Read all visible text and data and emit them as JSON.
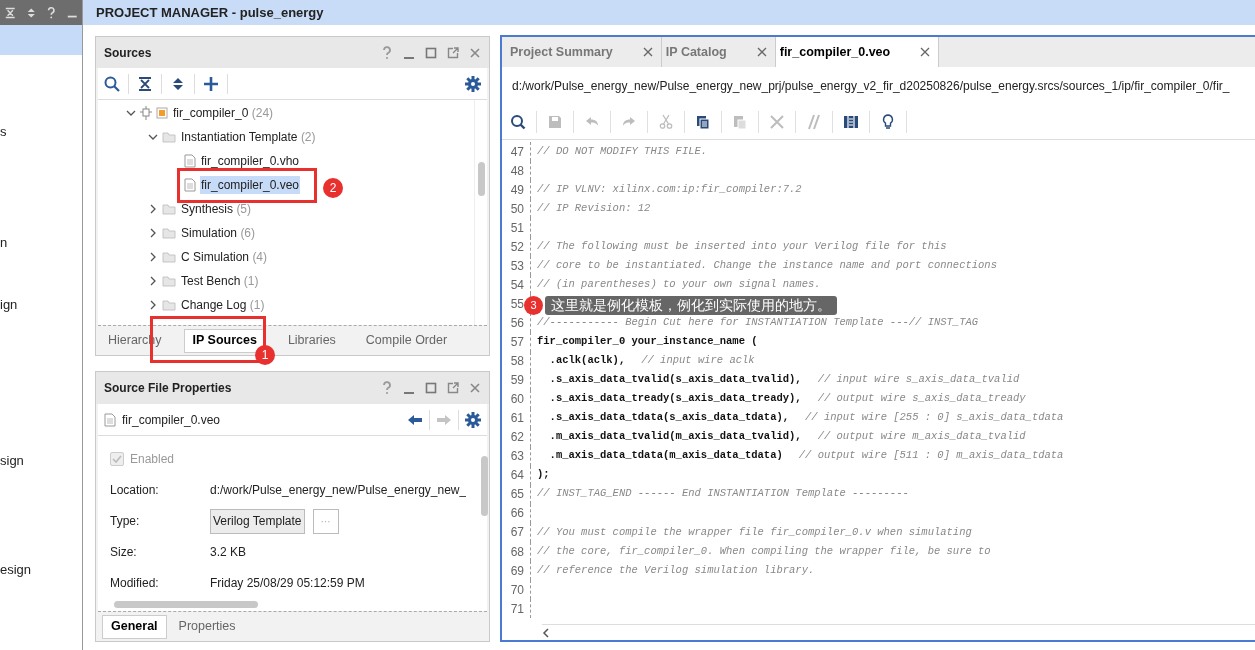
{
  "left_nav": {
    "items": [
      {
        "label": "s"
      },
      {
        "label": "n"
      },
      {
        "label": "ign"
      },
      {
        "label": "sign"
      },
      {
        "label": "esign"
      }
    ]
  },
  "title": "PROJECT MANAGER - pulse_energy",
  "sources": {
    "title": "Sources",
    "tree": [
      {
        "label": "fir_compiler_0",
        "count": "(24)",
        "kind": "ip",
        "expanded": true,
        "children": [
          {
            "label": "Instantiation Template",
            "count": "(2)",
            "kind": "folder",
            "expanded": true,
            "children": [
              {
                "label": "fir_compiler_0.vho",
                "kind": "file",
                "selected": false
              },
              {
                "label": "fir_compiler_0.veo",
                "kind": "file",
                "selected": true
              }
            ]
          },
          {
            "label": "Synthesis",
            "count": "(5)",
            "kind": "folder",
            "expanded": false
          },
          {
            "label": "Simulation",
            "count": "(6)",
            "kind": "folder",
            "expanded": false
          },
          {
            "label": "C Simulation",
            "count": "(4)",
            "kind": "folder",
            "expanded": false
          },
          {
            "label": "Test Bench",
            "count": "(1)",
            "kind": "folder",
            "expanded": false
          },
          {
            "label": "Change Log",
            "count": "(1)",
            "kind": "folder",
            "expanded": false
          }
        ]
      }
    ],
    "tabs": [
      {
        "label": "Hierarchy",
        "selected": false
      },
      {
        "label": "IP Sources",
        "selected": true
      },
      {
        "label": "Libraries",
        "selected": false
      },
      {
        "label": "Compile Order",
        "selected": false
      }
    ]
  },
  "properties": {
    "title": "Source File Properties",
    "file": "fir_compiler_0.veo",
    "enabled": {
      "label": "Enabled",
      "checked": true,
      "disabled": true
    },
    "fields": [
      {
        "label": "Location:",
        "value": "d:/work/Pulse_energy_new/Pulse_energy_new_",
        "kind": "text"
      },
      {
        "label": "Type:",
        "value": "Verilog Template",
        "kind": "button",
        "extra": "···"
      },
      {
        "label": "Size:",
        "value": "3.2 KB",
        "kind": "text"
      },
      {
        "label": "Modified:",
        "value": "Friday 25/08/29 05:12:59 PM",
        "kind": "text"
      }
    ],
    "tabs": [
      {
        "label": "General",
        "selected": true
      },
      {
        "label": "Properties",
        "selected": false
      }
    ]
  },
  "editor": {
    "tabs": [
      {
        "label": "Project Summary",
        "selected": false
      },
      {
        "label": "IP Catalog",
        "selected": false
      },
      {
        "label": "fir_compiler_0.veo",
        "selected": true
      }
    ],
    "path": "d:/work/Pulse_energy_new/Pulse_energy_new_prj/pulse_energy_v2_fir_d20250826/pulse_energy.srcs/sources_1/ip/fir_compiler_0/fir_",
    "toolbar": [
      {
        "disabled": false
      },
      {
        "disabled": true
      },
      {
        "disabled": true
      },
      {
        "disabled": true
      },
      {
        "disabled": true
      },
      {
        "disabled": false
      },
      {
        "disabled": true
      },
      {
        "disabled": true
      },
      {
        "disabled": true
      },
      {
        "disabled": false
      },
      {
        "disabled": false
      }
    ],
    "lines": [
      {
        "number": "47",
        "text": "// DO NOT MODIFY THIS FILE.",
        "kind": "comment"
      },
      {
        "number": "48"
      },
      {
        "number": "49",
        "text": "// IP VLNV: xilinx.com:ip:fir_compiler:7.2",
        "kind": "comment"
      },
      {
        "number": "50",
        "text": "// IP Revision: 12",
        "kind": "comment"
      },
      {
        "number": "51"
      },
      {
        "number": "52",
        "text": "// The following must be inserted into your Verilog file for this",
        "kind": "comment"
      },
      {
        "number": "53",
        "text": "// core to be instantiated. Change the instance name and port connections",
        "kind": "comment"
      },
      {
        "number": "54",
        "text": "// (in parentheses) to your own signal names.",
        "kind": "comment"
      },
      {
        "number": "55"
      },
      {
        "number": "56",
        "text": "//----------- Begin Cut here for INSTANTIATION Template ---// INST_TAG",
        "kind": "comment"
      },
      {
        "number": "57",
        "text": "fir_compiler_0 your_instance_name (",
        "kind": "code"
      },
      {
        "number": "58",
        "text": "  .aclk(aclk),",
        "comment": "// input wire aclk",
        "kind": "code"
      },
      {
        "number": "59",
        "text": "  .s_axis_data_tvalid(s_axis_data_tvalid),",
        "comment": "// input wire s_axis_data_tvalid",
        "kind": "code"
      },
      {
        "number": "60",
        "text": "  .s_axis_data_tready(s_axis_data_tready),",
        "comment": "// output wire s_axis_data_tready",
        "kind": "code"
      },
      {
        "number": "61",
        "text": "  .s_axis_data_tdata(s_axis_data_tdata),",
        "comment": "// input wire [255 : 0] s_axis_data_tdata",
        "kind": "code"
      },
      {
        "number": "62",
        "text": "  .m_axis_data_tvalid(m_axis_data_tvalid),",
        "comment": "// output wire m_axis_data_tvalid",
        "kind": "code"
      },
      {
        "number": "63",
        "text": "  .m_axis_data_tdata(m_axis_data_tdata)",
        "comment": "// output wire [511 : 0] m_axis_data_tdata",
        "kind": "code"
      },
      {
        "number": "64",
        "text": ");",
        "kind": "code"
      },
      {
        "number": "65",
        "text": "// INST_TAG_END ------ End INSTANTIATION Template ---------",
        "kind": "comment"
      },
      {
        "number": "66"
      },
      {
        "number": "67",
        "text": "// You must compile the wrapper file fir_compiler_0.v when simulating",
        "kind": "comment"
      },
      {
        "number": "68",
        "text": "// the core, fir_compiler_0. When compiling the wrapper file, be sure to",
        "kind": "comment"
      },
      {
        "number": "69",
        "text": "// reference the Verilog simulation library.",
        "kind": "comment"
      },
      {
        "number": "70"
      },
      {
        "number": "71"
      }
    ]
  },
  "annotations": [
    {
      "number": "1",
      "kind": "tab-callout"
    },
    {
      "number": "2",
      "kind": "tree-callout"
    },
    {
      "number": "3",
      "kind": "tooltip",
      "text": "这里就是例化模板，例化到实际使用的地方。"
    }
  ]
}
